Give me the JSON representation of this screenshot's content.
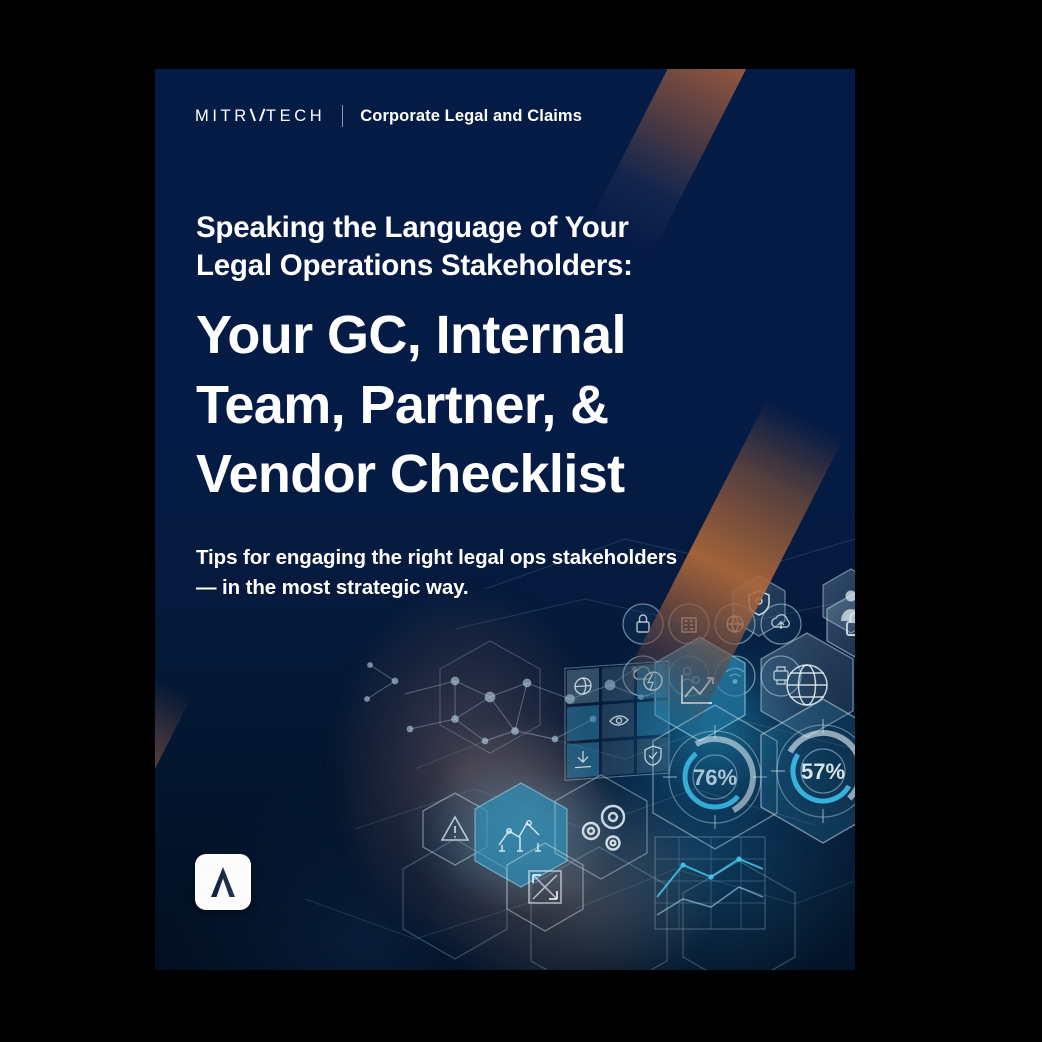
{
  "page": {
    "background_color": "#041B46",
    "outer_color": "#000000",
    "accent_copper": "#B0683A",
    "accent_orange": "#E89638",
    "accent_teal": "#2AAAD7"
  },
  "header": {
    "brand_before": "MITR",
    "brand_lambda_icon": "lambda-a-icon",
    "brand_after": "TECH",
    "brand_full": "MITRATECH",
    "divider": "vertical-divider",
    "product": "Corporate Legal and Claims"
  },
  "hero": {
    "eyebrow_line1": "Speaking the Language of Your",
    "eyebrow_line2": "Legal Operations Stakeholders:",
    "headline_line1": "Your GC, Internal",
    "headline_line2": "Team, Partner, &",
    "headline_line3": "Vendor Checklist",
    "subhead_line1": "Tips for engaging the right legal ops stakeholders",
    "subhead_line2": "— in the most strategic way."
  },
  "badge": {
    "name": "mitratech-mark-badge",
    "icon": "lambda-chevron-icon"
  },
  "graphic": {
    "description": "Hand interacting with holographic technology interface",
    "gauges": [
      {
        "label": "76%",
        "name": "gauge-76"
      },
      {
        "label": "57%",
        "name": "gauge-57"
      }
    ],
    "circle_icons": [
      "lock-icon",
      "building-icon",
      "globe-network-icon",
      "cloud-upload-icon",
      "cloud-icon",
      "user-settings-icon",
      "wifi-icon",
      "printer-icon"
    ],
    "hex_icons": [
      "lock-hex-icon",
      "line-chart-hex-icon",
      "globe-hex-icon",
      "shield-hex-icon",
      "person-hex-icon",
      "network-nodes-hex-icon",
      "gears-hex-icon",
      "warning-triangle-hex-icon",
      "expand-arrows-hex-icon"
    ],
    "tile_icons": [
      "globe-tile-icon",
      "lightning-tile-icon",
      "eye-tile-icon",
      "download-tile-icon",
      "shield-check-tile-icon"
    ]
  }
}
